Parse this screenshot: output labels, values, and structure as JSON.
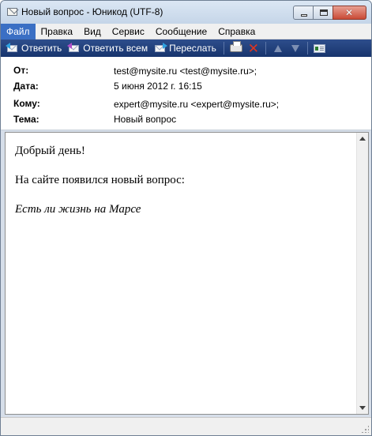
{
  "window": {
    "title": "Новый вопрос - Юникод (UTF-8)"
  },
  "menu": [
    {
      "label": "Файл",
      "active": true
    },
    {
      "label": "Правка"
    },
    {
      "label": "Вид"
    },
    {
      "label": "Сервис"
    },
    {
      "label": "Сообщение"
    },
    {
      "label": "Справка"
    }
  ],
  "toolbar": {
    "reply_label": "Ответить",
    "reply_all_label": "Ответить всем",
    "forward_label": "Переслать",
    "icons": [
      "reply-icon",
      "reply-all-icon",
      "forward-icon",
      "print-icon",
      "delete-icon",
      "previous-icon",
      "next-icon",
      "contacts-icon"
    ]
  },
  "headers": {
    "from_label": "От:",
    "from_value": "test@mysite.ru <test@mysite.ru>;",
    "date_label": "Дата:",
    "date_value": "5 июня 2012 г. 16:15",
    "to_label": "Кому:",
    "to_value": "expert@mysite.ru <expert@mysite.ru>;",
    "subject_label": "Тема:",
    "subject_value": "Новый вопрос"
  },
  "message": {
    "greeting": "Добрый день!",
    "line1": "На сайте появился новый вопрос:",
    "question": "Есть ли жизнь на Марсе"
  },
  "colors": {
    "toolbar_bg": "#17346d",
    "menu_active_bg": "#3a6fc4",
    "delete_red": "#e03520"
  }
}
